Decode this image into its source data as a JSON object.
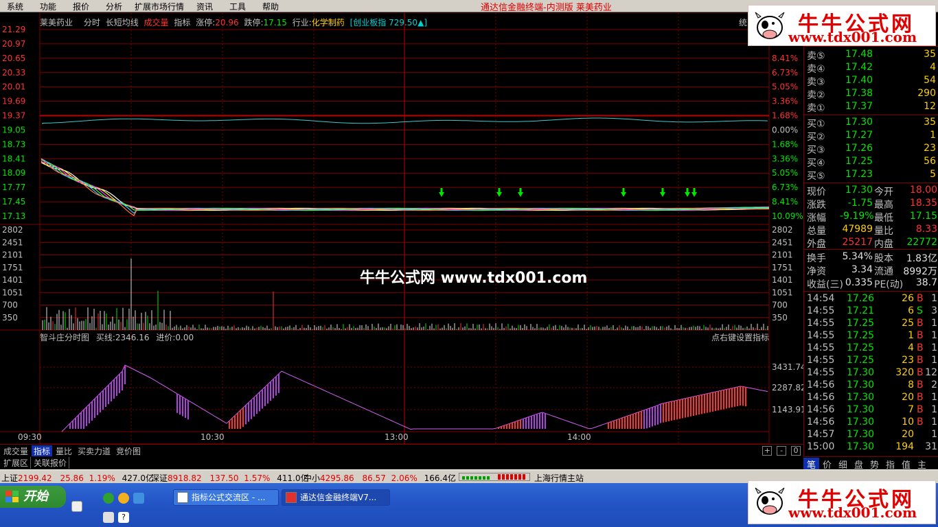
{
  "menu": {
    "items": [
      "系统",
      "功能",
      "报价",
      "分析",
      "扩展市场行情",
      "资讯",
      "工具",
      "帮助"
    ],
    "app_title": "通达信金融终端-内测版  莱美药业"
  },
  "header": {
    "stock_name": "莱美药业",
    "fenshi": "分时",
    "indicator": "长短均线",
    "volume_label": "成交量",
    "indicator_label": "指标",
    "limit_up_label": "涨停:",
    "limit_up_value": "20.96",
    "limit_down_label": "跌停:",
    "limit_down_value": "17.15",
    "industry_label": "行业:",
    "industry_value": "化学制药",
    "index_label": "[创业板指 729.50▲]",
    "stat_label": "统"
  },
  "price_axis": {
    "left": [
      "21.29",
      "20.97",
      "20.65",
      "20.33",
      "20.01",
      "19.69",
      "19.37",
      "19.05",
      "18.73",
      "18.41",
      "18.09",
      "17.77",
      "17.45",
      "17.13"
    ],
    "right": [
      "8.41%",
      "6.73%",
      "5.05%",
      "3.36%",
      "1.68%",
      "0.00%",
      "1.68%",
      "3.36%",
      "5.05%",
      "6.73%",
      "8.41%",
      "10.09%"
    ]
  },
  "volume_axis": [
    "2802",
    "2451",
    "2101",
    "1751",
    "1401",
    "1051",
    "700",
    "350"
  ],
  "indicator_panel": {
    "title": "智斗庄分时图",
    "buy_line": "买线:2346.16",
    "entry_price": "进价:0.00",
    "hint": "点右键设置指标",
    "axis": [
      "3431.74",
      "2287.82",
      "1143.91"
    ]
  },
  "time_axis": [
    "09:30",
    "10:30",
    "13:00",
    "14:00"
  ],
  "watermark": "牛牛公式网 www.tdx001.com",
  "bottom_tabs": [
    "成交量",
    "指标",
    "量比",
    "买卖力道",
    "竞价图"
  ],
  "zoom_buttons": [
    "+",
    "-",
    "0"
  ],
  "ext_tabs": [
    "扩展区",
    "关联报价"
  ],
  "order_book": {
    "asks": [
      {
        "label": "卖⑤",
        "price": "17.48",
        "vol": "35"
      },
      {
        "label": "卖④",
        "price": "17.42",
        "vol": "4"
      },
      {
        "label": "卖③",
        "price": "17.40",
        "vol": "54"
      },
      {
        "label": "卖②",
        "price": "17.38",
        "vol": "290"
      },
      {
        "label": "卖①",
        "price": "17.37",
        "vol": "12"
      }
    ],
    "bids": [
      {
        "label": "买①",
        "price": "17.30",
        "vol": "35"
      },
      {
        "label": "买②",
        "price": "17.27",
        "vol": "1"
      },
      {
        "label": "买③",
        "price": "17.26",
        "vol": "23"
      },
      {
        "label": "买④",
        "price": "17.25",
        "vol": "56"
      },
      {
        "label": "买⑤",
        "price": "17.23",
        "vol": "5"
      }
    ]
  },
  "stats": [
    {
      "l1": "现价",
      "v1": "17.30",
      "l2": "今开",
      "v2": "18.00",
      "c1": "green",
      "c2": "red"
    },
    {
      "l1": "涨跌",
      "v1": "-1.75",
      "l2": "最高",
      "v2": "18.35",
      "c1": "green",
      "c2": "red"
    },
    {
      "l1": "涨幅",
      "v1": "-9.19%",
      "l2": "最低",
      "v2": "17.15",
      "c1": "green",
      "c2": "green"
    },
    {
      "l1": "总量",
      "v1": "47989",
      "l2": "量比",
      "v2": "8.33",
      "c1": "yellow",
      "c2": "red"
    },
    {
      "l1": "外盘",
      "v1": "25217",
      "l2": "内盘",
      "v2": "22772",
      "c1": "red",
      "c2": "green"
    },
    {
      "l1": "换手",
      "v1": "5.34%",
      "l2": "股本",
      "v2": "1.83亿",
      "c1": "white",
      "c2": "white"
    },
    {
      "l1": "净资",
      "v1": "3.34",
      "l2": "流通",
      "v2": "8992万",
      "c1": "white",
      "c2": "white"
    },
    {
      "l1": "收益(三)",
      "v1": "0.335",
      "l2": "PE(动)",
      "v2": "38.7",
      "c1": "white",
      "c2": "white"
    }
  ],
  "ticks": [
    {
      "t": "14:54",
      "p": "17.26",
      "v": "26",
      "bs": "B",
      "n": "1"
    },
    {
      "t": "14:55",
      "p": "17.21",
      "v": "6",
      "bs": "S",
      "n": "3"
    },
    {
      "t": "14:55",
      "p": "17.25",
      "v": "25",
      "bs": "B",
      "n": "1"
    },
    {
      "t": "14:55",
      "p": "17.25",
      "v": "1",
      "bs": "B",
      "n": "1"
    },
    {
      "t": "14:55",
      "p": "17.25",
      "v": "4",
      "bs": "B",
      "n": "1"
    },
    {
      "t": "14:55",
      "p": "17.25",
      "v": "23",
      "bs": "B",
      "n": "1"
    },
    {
      "t": "14:55",
      "p": "17.30",
      "v": "320",
      "bs": "B",
      "n": "12"
    },
    {
      "t": "14:56",
      "p": "17.30",
      "v": "8",
      "bs": "B",
      "n": "2"
    },
    {
      "t": "14:56",
      "p": "17.30",
      "v": "20",
      "bs": "B",
      "n": "1"
    },
    {
      "t": "14:56",
      "p": "17.30",
      "v": "7",
      "bs": "B",
      "n": "1"
    },
    {
      "t": "14:56",
      "p": "17.30",
      "v": "10",
      "bs": "B",
      "n": "1"
    },
    {
      "t": "14:57",
      "p": "17.30",
      "v": "20",
      "bs": "",
      "n": "1"
    },
    {
      "t": "15:00",
      "p": "17.30",
      "v": "194",
      "bs": "",
      "n": "31"
    }
  ],
  "rp_tabs": [
    "笔",
    "价",
    "细",
    "盘",
    "势",
    "指",
    "值",
    "主"
  ],
  "status": {
    "sh_name": "上证",
    "sh_val": "2199.42",
    "sh_chg": "25.86",
    "sh_pct": "1.19%",
    "sh_amt": "427.0亿",
    "sz_name": "深证",
    "sz_val": "8918.82",
    "sz_chg": "137.50",
    "sz_pct": "1.57%",
    "sz_amt": "411.0亿",
    "zx_name": "中小",
    "zx_val": "4295.86",
    "zx_chg": "86.57",
    "zx_pct": "2.06%",
    "zx_amt": "166.4亿",
    "station": "上海行情主站"
  },
  "taskbar": {
    "start": "开始",
    "task1": "指标公式交流区 - ...",
    "task2": "通达信金融终端V7..."
  },
  "logo": {
    "brand": "牛牛公式网",
    "url": "www.tdx001.com"
  },
  "colors": {
    "up": "#ff3232",
    "down": "#00e600",
    "price_line": "#40c8c8",
    "grid_red": "#800000",
    "purple": "#b040e0"
  }
}
